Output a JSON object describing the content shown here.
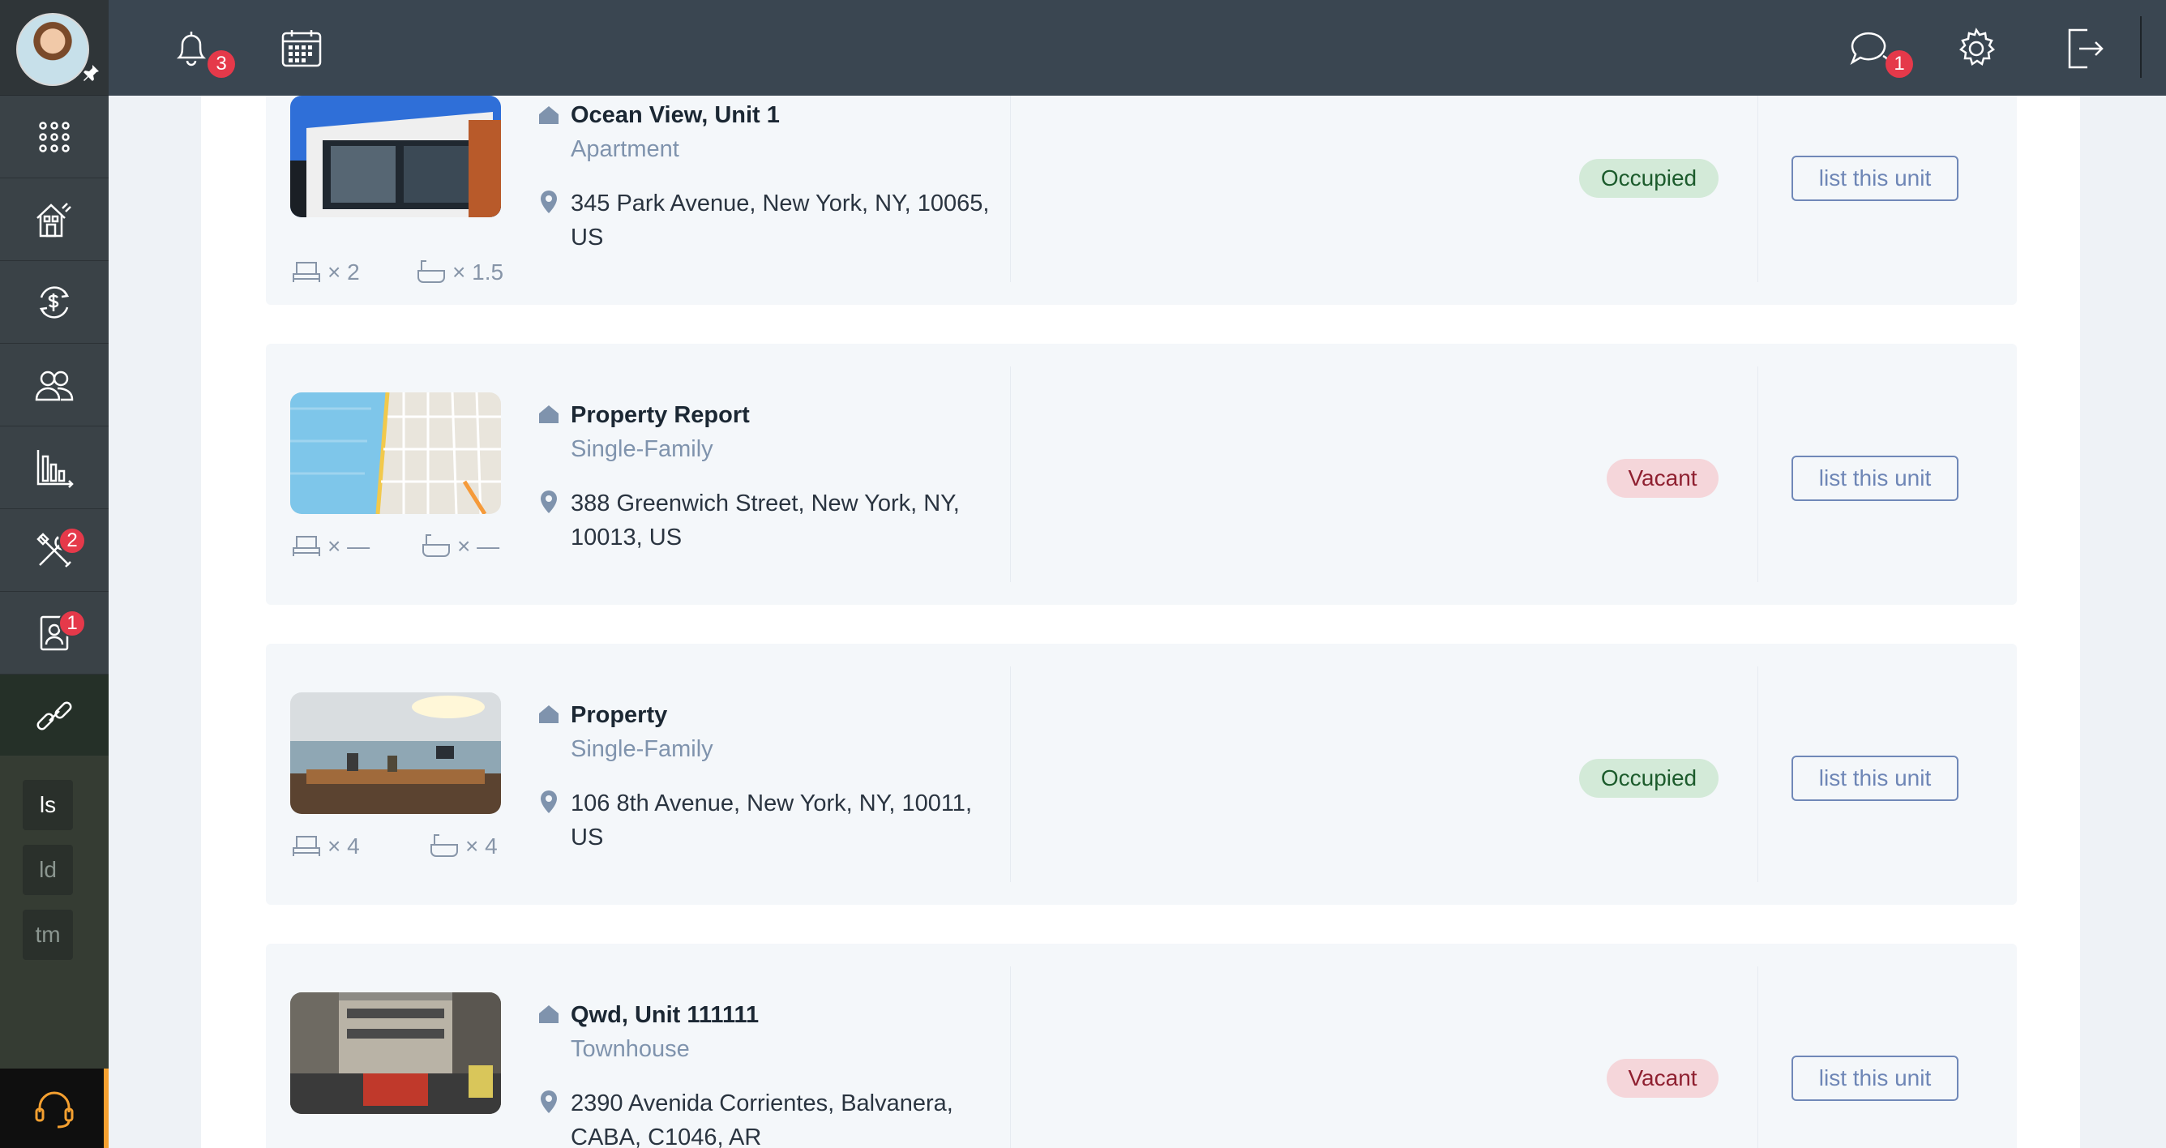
{
  "topbar": {
    "notifications_count": "3",
    "messages_count": "1",
    "icons": [
      "bell-icon",
      "calendar-icon",
      "chat-icon",
      "gear-icon",
      "logout-icon"
    ]
  },
  "sidebar": {
    "items": [
      {
        "icon": "apps-grid-icon"
      },
      {
        "icon": "property-icon"
      },
      {
        "icon": "finance-icon"
      },
      {
        "icon": "people-icon"
      },
      {
        "icon": "reports-icon"
      },
      {
        "icon": "maintenance-icon",
        "badge": "2"
      },
      {
        "icon": "tenant-file-icon",
        "badge": "1"
      },
      {
        "icon": "link-icon"
      }
    ],
    "chips": [
      "ls",
      "ld",
      "tm"
    ],
    "support_icon": "headset-icon"
  },
  "listings": [
    {
      "name": "Ocean View, Unit 1",
      "type": "Apartment",
      "address": "345 Park Avenue, New York, NY, 10065, US",
      "beds": "× 2",
      "baths": "× 1.5",
      "status": "Occupied",
      "action": "list this unit"
    },
    {
      "name": "Property Report",
      "type": "Single-Family",
      "address": "388 Greenwich Street, New York, NY, 10013, US",
      "beds": "× —",
      "baths": "× —",
      "status": "Vacant",
      "action": "list this unit"
    },
    {
      "name": "Property",
      "type": "Single-Family",
      "address": "106 8th Avenue, New York, NY, 10011, US",
      "beds": "× 4",
      "baths": "× 4",
      "status": "Occupied",
      "action": "list this unit"
    },
    {
      "name": "Qwd, Unit 111111",
      "type": "Townhouse",
      "address": "2390 Avenida Corrientes, Balvanera, CABA, C1046, AR",
      "beds": "",
      "baths": "",
      "status": "Vacant",
      "action": "list this unit"
    }
  ],
  "colors": {
    "sidebar": "#3a4247",
    "topbar": "#3a4651",
    "badge": "#e5394a",
    "occupied_bg": "#d3ead8",
    "vacant_bg": "#f5d6da",
    "link": "#6e86b6"
  }
}
